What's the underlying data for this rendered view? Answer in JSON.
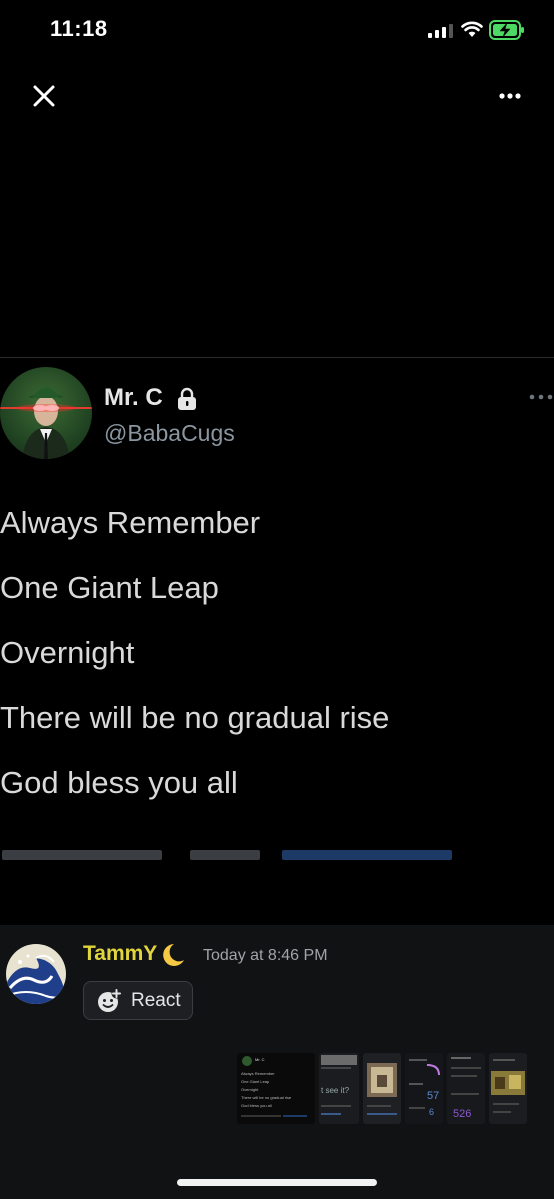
{
  "status_bar": {
    "time": "11:18"
  },
  "tweet": {
    "display_name": "Mr. C",
    "handle": "@BabaCugs",
    "lines": [
      "Always Remember",
      "One Giant Leap",
      "Overnight",
      "There will be no gradual rise",
      "God bless you all"
    ]
  },
  "message": {
    "username": "TammY",
    "timestamp": "Today at 8:46 PM",
    "react_label": "React"
  },
  "thumbnails": [
    {
      "name": "tweet-screenshot",
      "lines": [
        "Mr. C",
        "Always Remember",
        "One Giant Leap",
        "Overnight",
        "There will be no gradual rise",
        "God bless you all"
      ]
    },
    {
      "name": "thumbnail-2",
      "text": "t see it?"
    },
    {
      "name": "thumbnail-3"
    },
    {
      "name": "thumbnail-4",
      "numbers": [
        "57",
        "6"
      ]
    },
    {
      "name": "thumbnail-5",
      "numbers": [
        "526"
      ]
    },
    {
      "name": "thumbnail-6"
    }
  ],
  "colors": {
    "background": "#000000",
    "username": "#e0d53c",
    "handle": "#8b96a0",
    "discord_bg": "#111214"
  }
}
